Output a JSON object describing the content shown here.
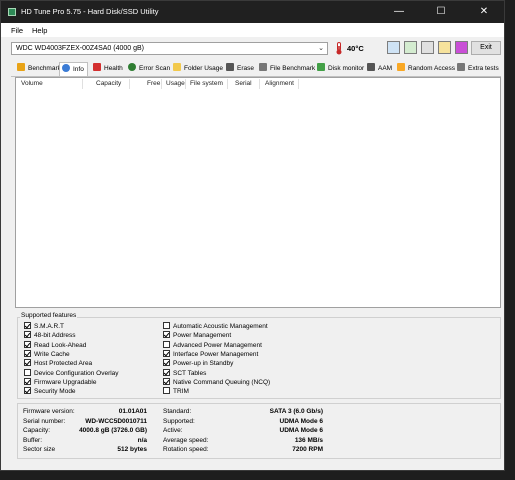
{
  "window": {
    "title": "HD Tune Pro 5.75 - Hard Disk/SSD Utility",
    "controls": {
      "minimize": "—",
      "maximize": "☐",
      "close": "✕"
    }
  },
  "menu": {
    "file": "File",
    "help": "Help"
  },
  "toolbar": {
    "drive": "WDC WD4003FZEX-00Z4SA0 (4000 gB)",
    "temperature": "40°C",
    "exit": "Exit",
    "icons": [
      "copy-info-icon",
      "copy-all-icon",
      "screenshot-icon",
      "options-icon",
      "save-icon"
    ]
  },
  "tabs": [
    {
      "label": "Benchmark",
      "icon": "benchmark-icon",
      "color": "#e8a317"
    },
    {
      "label": "Info",
      "icon": "info-icon",
      "color": "#3a7bd5"
    },
    {
      "label": "Health",
      "icon": "health-icon",
      "color": "#d32f2f"
    },
    {
      "label": "Error Scan",
      "icon": "error-scan-icon",
      "color": "#2e7d32"
    },
    {
      "label": "Folder Usage",
      "icon": "folder-icon",
      "color": "#f2c94c"
    },
    {
      "label": "Erase",
      "icon": "erase-icon",
      "color": "#555555"
    },
    {
      "label": "File Benchmark",
      "icon": "file-benchmark-icon",
      "color": "#777777"
    },
    {
      "label": "Disk monitor",
      "icon": "disk-monitor-icon",
      "color": "#43a047"
    },
    {
      "label": "AAM",
      "icon": "aam-icon",
      "color": "#555555"
    },
    {
      "label": "Random Access",
      "icon": "random-access-icon",
      "color": "#f9a825"
    },
    {
      "label": "Extra tests",
      "icon": "extra-tests-icon",
      "color": "#777777"
    }
  ],
  "volumes": {
    "columns": [
      "Volume",
      "Capacity",
      "Free",
      "Usage",
      "File system",
      "Serial",
      "Alignment"
    ],
    "rows": []
  },
  "features": {
    "label": "Supported features",
    "left": [
      {
        "label": "S.M.A.R.T",
        "checked": true
      },
      {
        "label": "48-bit Address",
        "checked": true
      },
      {
        "label": "Read Look-Ahead",
        "checked": true
      },
      {
        "label": "Write Cache",
        "checked": true
      },
      {
        "label": "Host Protected Area",
        "checked": true
      },
      {
        "label": "Device Configuration Overlay",
        "checked": false
      },
      {
        "label": "Firmware Upgradable",
        "checked": true
      },
      {
        "label": "Security Mode",
        "checked": true
      }
    ],
    "right": [
      {
        "label": "Automatic Acoustic Management",
        "checked": false
      },
      {
        "label": "Power Management",
        "checked": true
      },
      {
        "label": "Advanced Power Management",
        "checked": false
      },
      {
        "label": "Interface Power Management",
        "checked": true
      },
      {
        "label": "Power-up in Standby",
        "checked": true
      },
      {
        "label": "SCT Tables",
        "checked": true
      },
      {
        "label": "Native Command Queuing (NCQ)",
        "checked": true
      },
      {
        "label": "TRIM",
        "checked": false
      }
    ]
  },
  "info": {
    "left": [
      {
        "label": "Firmware version:",
        "value": "01.01A01"
      },
      {
        "label": "Serial number:",
        "value": "WD-WCC5D0010711"
      },
      {
        "label": "Capacity:",
        "value": "4000.8 gB (3726.0 GB)"
      },
      {
        "label": "Buffer:",
        "value": "n/a"
      },
      {
        "label": "Sector size",
        "value": "512 bytes"
      }
    ],
    "right": [
      {
        "label": "Standard:",
        "value": "SATA 3 (6.0 Gb/s)"
      },
      {
        "label": "Supported:",
        "value": "UDMA Mode 6"
      },
      {
        "label": "Active:",
        "value": "UDMA Mode 6"
      },
      {
        "label": "Average speed:",
        "value": "136 MB/s"
      },
      {
        "label": "Rotation speed:",
        "value": "7200 RPM"
      }
    ]
  }
}
